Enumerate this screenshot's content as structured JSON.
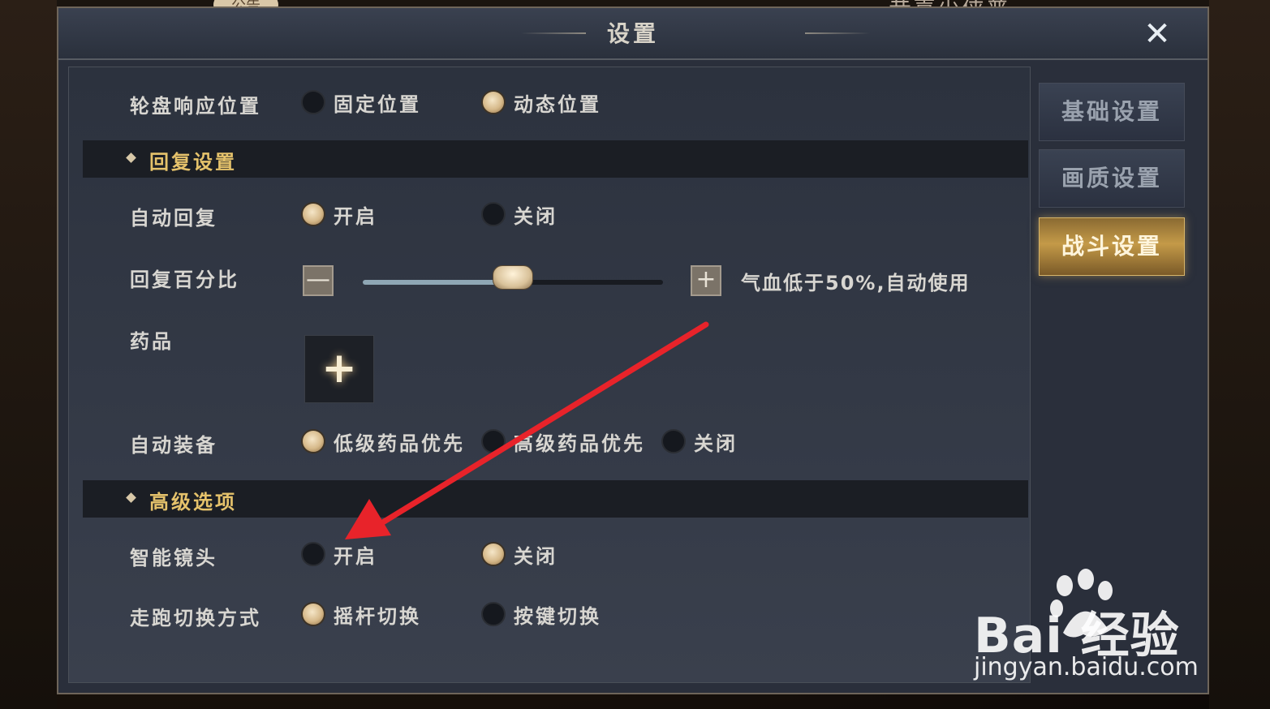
{
  "background": {
    "notice_tab": "公告",
    "top_text": "恭喜少侠普"
  },
  "window": {
    "title": "设置",
    "close_label": "✕"
  },
  "settings": {
    "wheel_position": {
      "label": "轮盘响应位置",
      "options": [
        {
          "label": "固定位置",
          "selected": false
        },
        {
          "label": "动态位置",
          "selected": true
        }
      ]
    },
    "recovery_section": "回复设置",
    "auto_recover": {
      "label": "自动回复",
      "options": [
        {
          "label": "开启",
          "selected": true
        },
        {
          "label": "关闭",
          "selected": false
        }
      ]
    },
    "recover_percent": {
      "label": "回复百分比",
      "minus": "—",
      "plus": "+",
      "value_fraction": 0.5,
      "hint": "气血低于50%,自动使用"
    },
    "medicine": {
      "label": "药品",
      "add": "+"
    },
    "auto_equip": {
      "label": "自动装备",
      "options": [
        {
          "label": "低级药品优先",
          "selected": true
        },
        {
          "label": "高级药品优先",
          "selected": false
        },
        {
          "label": "关闭",
          "selected": false
        }
      ]
    },
    "advanced_section": "高级选项",
    "smart_camera": {
      "label": "智能镜头",
      "options": [
        {
          "label": "开启",
          "selected": false
        },
        {
          "label": "关闭",
          "selected": true
        }
      ]
    },
    "run_switch": {
      "label": "走跑切换方式",
      "options": [
        {
          "label": "摇杆切换",
          "selected": true
        },
        {
          "label": "按键切换",
          "selected": false
        }
      ]
    }
  },
  "side_tabs": [
    {
      "label": "基础设置",
      "active": false
    },
    {
      "label": "画质设置",
      "active": false
    },
    {
      "label": "战斗设置",
      "active": true
    }
  ],
  "watermark": {
    "brand": "Bai  经验",
    "url": "jingyan.baidu.com"
  },
  "colors": {
    "accent_gold": "#e5c26b",
    "annotation_arrow": "#e8232a"
  }
}
